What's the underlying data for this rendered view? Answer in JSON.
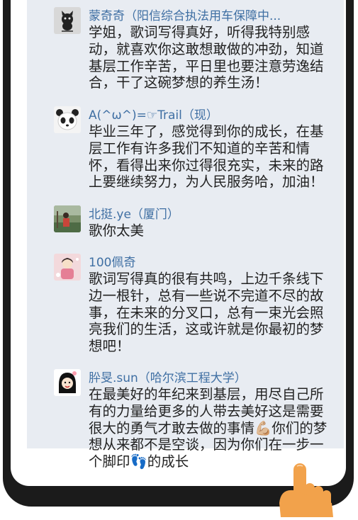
{
  "comments": [
    {
      "name": "蒙奇奇（阳信综合执法用车保障中...",
      "text": " 学姐，歌词写得真好，听得我特别感动，就喜欢你这敢想敢做的冲劲，知道基层工作辛苦，平日里也要注意劳逸结合，干了这碗梦想的养生汤！",
      "avatar_icon": "cat-avatar-icon"
    },
    {
      "name": "A(^ω^)=☞Trail（现）",
      "text": "毕业三年了，感觉得到你的成长，在基层工作有许多我们不知道的辛苦和情怀，看得出来你过得很充实，未来的路上要继续努力，为人民服务哈，加油！",
      "avatar_icon": "panda-avatar-icon"
    },
    {
      "name": "北挺.ye（厦门）",
      "text": "歌你太美",
      "avatar_icon": "outdoor-photo-avatar-icon"
    },
    {
      "name": "100佩奇",
      "text": "歌词写得真的很有共鸣，上边千条线下边一根针，总有一些说不完道不尽的故事，在未来的分叉口，总有一束光会照亮我们的生活，这或许就是你最初的梦想吧！",
      "avatar_icon": "cartoon-girl-avatar-icon"
    },
    {
      "name": "肸旻.sun（哈尔滨工程大学）",
      "text": "在最美好的年纪来到基层，用尽自己所有的力量给更多的人带去美好这是需要很大的勇气才敢去做的事情💪🏼你们的梦想从来都不是空谈，因为你们在一步一个脚印👣的成长",
      "avatar_icon": "girl-avatar-icon"
    }
  ],
  "colors": {
    "comment_bg": "#e8ecf2",
    "name": "#3f6fa3",
    "text": "#222222",
    "frame": "#1b1b1b",
    "hand": "#f2a24b"
  }
}
